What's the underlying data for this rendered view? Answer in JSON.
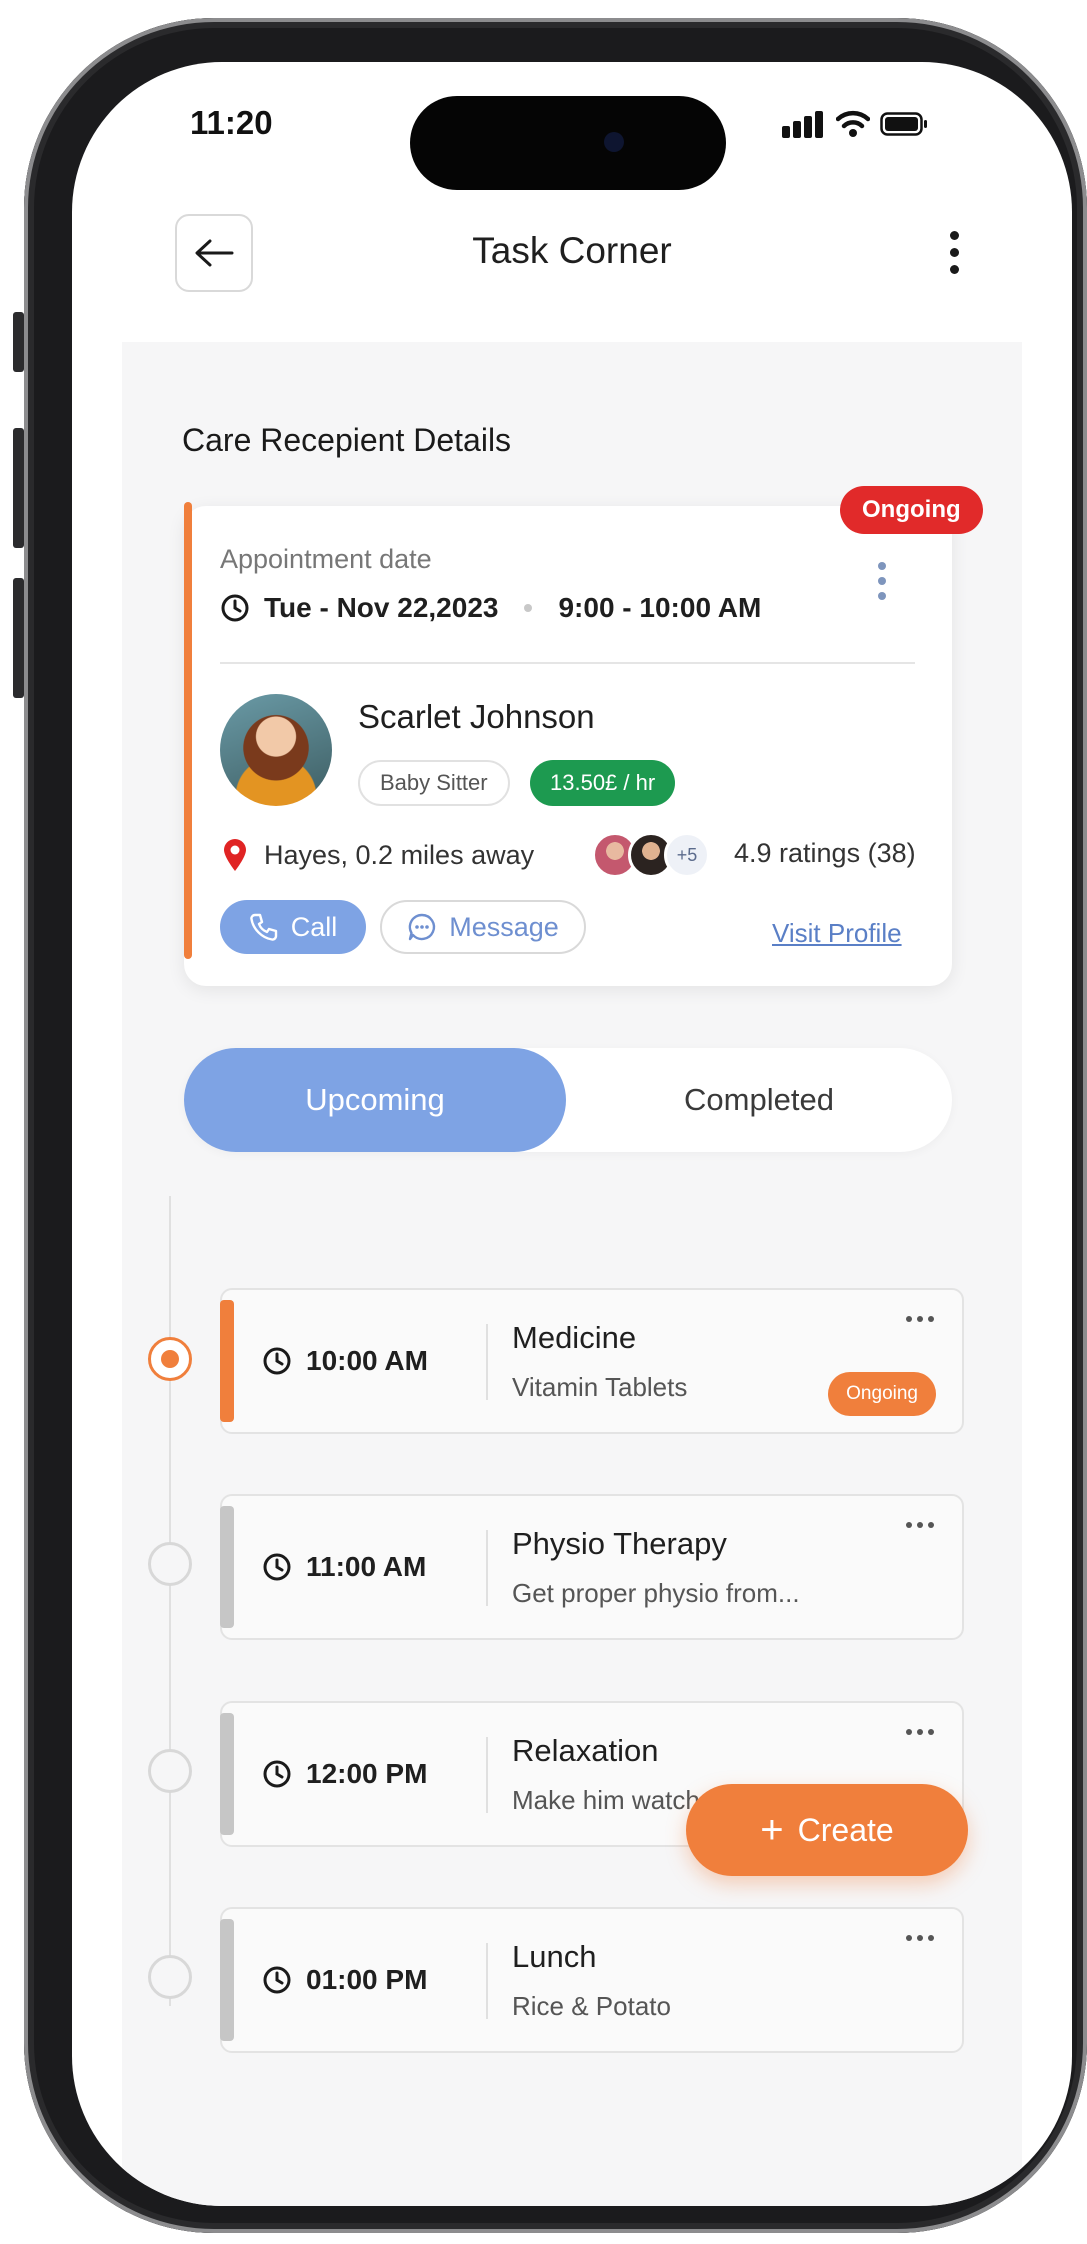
{
  "status_bar": {
    "time": "11:20"
  },
  "header": {
    "title": "Task Corner"
  },
  "section": {
    "title": "Care Recepient Details"
  },
  "appointment": {
    "status_badge": "Ongoing",
    "label": "Appointment date",
    "date": "Tue - Nov 22,2023",
    "time_range": "9:00 - 10:00 AM",
    "person": {
      "name": "Scarlet Johnson",
      "role": "Baby Sitter",
      "rate": "13.50£ / hr",
      "location": "Hayes, 0.2 miles away",
      "raters_more": "+5",
      "ratings": "4.9 ratings (38)"
    },
    "actions": {
      "call": "Call",
      "message": "Message",
      "visit_profile": "Visit Profile"
    }
  },
  "tabs": [
    {
      "label": "Upcoming",
      "active": true
    },
    {
      "label": "Completed",
      "active": false
    }
  ],
  "tasks": [
    {
      "time": "10:00 AM",
      "title": "Medicine",
      "subtitle": "Vitamin Tablets",
      "status": "Ongoing",
      "active": true
    },
    {
      "time": "11:00 AM",
      "title": "Physio Therapy",
      "subtitle": "Get proper physio from...",
      "active": false
    },
    {
      "time": "12:00 PM",
      "title": "Relaxation",
      "subtitle": "Make him watch a movie...",
      "active": false
    },
    {
      "time": "01:00 PM",
      "title": "Lunch",
      "subtitle": "Rice & Potato",
      "active": false
    }
  ],
  "fab": {
    "label": "Create"
  },
  "colors": {
    "accent_orange": "#f07f3c",
    "accent_blue": "#7ea3e4",
    "badge_red": "#e12a2a",
    "rate_green": "#1d9a50"
  }
}
